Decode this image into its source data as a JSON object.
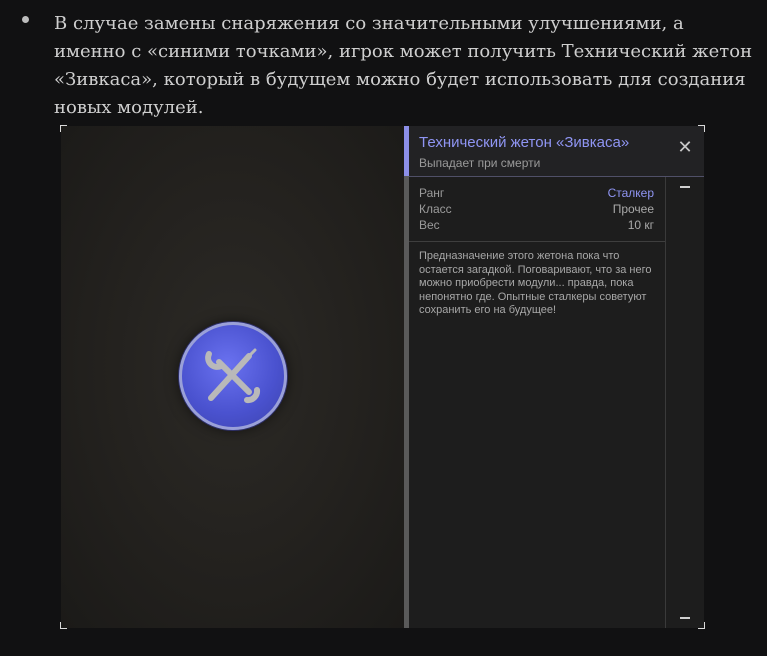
{
  "article": {
    "paragraph": "В случае замены снаряжения со значительными улучшениями, а именно с «синими точками», игрок может получить Технический жетон «Зивкаса», который в будущем можно будет использовать для создания новых модулей."
  },
  "item_card": {
    "title": "Технический жетон «Зивкаса»",
    "subtitle": "Выпадает при смерти",
    "close_icon": "close-icon",
    "stats": [
      {
        "label": "Ранг",
        "value": "Сталкер"
      },
      {
        "label": "Класс",
        "value": "Прочее"
      },
      {
        "label": "Вес",
        "value": "10 кг"
      }
    ],
    "description": "Предназначение этого жетона пока что остается загадкой. Поговаривают, что за него можно приобрести модули... правда, пока непонятно где. Опытные сталкеры советуют сохранить его на будущее!"
  },
  "colors": {
    "accent": "#8f95f3",
    "token_blue": "#4a52cf",
    "background": "#111112"
  }
}
